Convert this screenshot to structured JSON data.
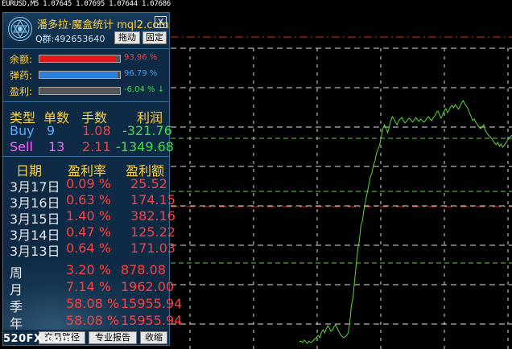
{
  "chart": {
    "symbol_info": "EURUSD,M5  1.07645 1.07695 1.07644 1.07686",
    "grid_color": "#e0e0e0",
    "red_line_color": "#d03020",
    "green_line_color": "#5cd83a",
    "price_series": [
      425,
      424,
      426,
      423,
      425,
      427,
      424,
      426,
      425,
      423,
      421,
      419,
      417,
      420,
      413,
      410,
      414,
      409,
      405,
      408,
      412,
      410,
      406,
      404,
      408,
      412,
      416,
      418,
      420,
      419,
      417,
      414,
      400,
      380,
      370,
      350,
      330,
      310,
      300,
      280,
      275,
      260,
      250,
      240,
      230,
      220,
      215,
      205,
      200,
      190,
      185,
      180,
      170,
      160,
      155,
      160,
      165,
      158,
      150,
      145,
      148,
      152,
      155,
      150,
      148,
      146,
      150,
      153,
      151,
      148,
      147,
      150,
      152,
      149,
      146,
      149,
      151,
      148,
      150,
      152,
      150,
      147,
      145,
      148,
      150,
      146,
      144,
      140,
      138,
      143,
      147,
      142,
      138,
      135,
      140,
      137,
      133,
      131,
      134,
      130,
      133,
      136,
      132,
      128,
      125,
      129,
      132,
      135,
      140,
      145,
      150,
      148,
      152,
      155,
      158,
      160,
      158,
      155,
      162,
      165,
      168,
      170,
      172,
      175,
      178,
      180,
      177,
      182,
      179,
      183,
      181,
      178,
      175,
      172,
      170,
      168
    ]
  },
  "panel": {
    "title": "潘多拉·魔盒统计 mql2.com",
    "qq": "Q群:492653640",
    "drag_button": "拖动",
    "fix_button": "固定",
    "close_glyph": "X",
    "bars": [
      {
        "label": "余额:",
        "percent": 93.96,
        "value": "93.96 %",
        "fill": "#e01818",
        "value_color": "#ff4040"
      },
      {
        "label": "弹药:",
        "percent": 96.79,
        "value": "96.79 %",
        "fill": "#2b7fd8",
        "value_color": "#3fa0ff"
      },
      {
        "label": "盈利:",
        "percent": 0,
        "value": "-6.04 % ↓",
        "fill": "#888888",
        "value_color": "#40e040"
      }
    ],
    "trades_header": [
      "类型",
      "单数",
      "手数",
      "利润"
    ],
    "trades": [
      {
        "type": "Buy",
        "count": "9",
        "lots": "1.08",
        "profit": "-321.76",
        "type_color": "#5aa8ff",
        "count_color": "#5aa8ff"
      },
      {
        "type": "Sell",
        "count": "13",
        "lots": "2.11",
        "profit": "-1349.68",
        "type_color": "#ff60ff",
        "count_color": "#ff60ff"
      }
    ],
    "daily_header": [
      "日期",
      "盈利率",
      "盈利额"
    ],
    "daily": [
      {
        "date": "3月17日",
        "rate": "0.09 %",
        "amount": "25.52"
      },
      {
        "date": "3月16日",
        "rate": "0.63 %",
        "amount": "174.15"
      },
      {
        "date": "3月15日",
        "rate": "1.40 %",
        "amount": "382.16"
      },
      {
        "date": "3月14日",
        "rate": "0.47 %",
        "amount": "125.22"
      },
      {
        "date": "3月13日",
        "rate": "0.64 %",
        "amount": "171.03"
      }
    ],
    "periods": [
      {
        "label": "周",
        "rate": "3.20 %",
        "amount": "878.08"
      },
      {
        "label": "月",
        "rate": "7.14 %",
        "amount": "1962.00"
      },
      {
        "label": "季",
        "rate": "58.08 %",
        "amount": "15955.94"
      },
      {
        "label": "年",
        "rate": "58.08 %",
        "amount": "15955.94"
      }
    ],
    "footer_buttons": [
      "交易路径",
      "专业报告",
      "收缩"
    ]
  },
  "watermark": "520FX.com"
}
